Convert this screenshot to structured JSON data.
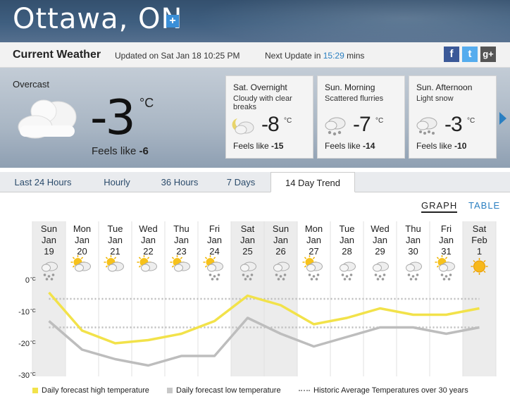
{
  "header": {
    "city": "Ottawa, ON",
    "add_label": "+"
  },
  "current_bar": {
    "title": "Current Weather",
    "updated": "Updated on Sat Jan 18 10:25 PM",
    "next_update_prefix": "Next Update in ",
    "next_update_time": "15:29",
    "next_update_suffix": " mins",
    "social": [
      "f",
      "t",
      "g+"
    ]
  },
  "current": {
    "condition": "Overcast",
    "temp": "-3",
    "unit": "°C",
    "feels_prefix": "Feels like ",
    "feels_value": "-6",
    "icon": "cloud-icon"
  },
  "forecast": [
    {
      "name": "Sat. Overnight",
      "cond": "Cloudy with clear breaks",
      "temp": "-8",
      "unit": "°C",
      "feels_prefix": "Feels like ",
      "feels_value": "-15",
      "icon": "cloudy-night-icon"
    },
    {
      "name": "Sun. Morning",
      "cond": "Scattered flurries",
      "temp": "-7",
      "unit": "°C",
      "feels_prefix": "Feels like ",
      "feels_value": "-14",
      "icon": "flurries-icon"
    },
    {
      "name": "Sun. Afternoon",
      "cond": "Light snow",
      "temp": "-3",
      "unit": "°C",
      "feels_prefix": "Feels like ",
      "feels_value": "-10",
      "icon": "snow-icon"
    }
  ],
  "tabs": [
    {
      "label": "Last 24 Hours",
      "active": false
    },
    {
      "label": "Hourly",
      "active": false
    },
    {
      "label": "36 Hours",
      "active": false
    },
    {
      "label": "7 Days",
      "active": false
    },
    {
      "label": "14 Day Trend",
      "active": true
    }
  ],
  "view_toggle": {
    "graph": "GRAPH",
    "table": "TABLE"
  },
  "chart_data": {
    "type": "line",
    "days": [
      {
        "dow": "Sun",
        "mon": "Jan",
        "day": "19",
        "icon": "snow-icon",
        "weekend": true
      },
      {
        "dow": "Mon",
        "mon": "Jan",
        "day": "20",
        "icon": "sun-cloud-icon",
        "weekend": false
      },
      {
        "dow": "Tue",
        "mon": "Jan",
        "day": "21",
        "icon": "sun-cloud-icon",
        "weekend": false
      },
      {
        "dow": "Wed",
        "mon": "Jan",
        "day": "22",
        "icon": "sun-cloud-icon",
        "weekend": false
      },
      {
        "dow": "Thu",
        "mon": "Jan",
        "day": "23",
        "icon": "sun-cloud-icon",
        "weekend": false
      },
      {
        "dow": "Fri",
        "mon": "Jan",
        "day": "24",
        "icon": "sun-flurries-icon",
        "weekend": false
      },
      {
        "dow": "Sat",
        "mon": "Jan",
        "day": "25",
        "icon": "snow-icon",
        "weekend": true
      },
      {
        "dow": "Sun",
        "mon": "Jan",
        "day": "26",
        "icon": "flurries-icon",
        "weekend": true
      },
      {
        "dow": "Mon",
        "mon": "Jan",
        "day": "27",
        "icon": "sun-flurries-icon",
        "weekend": false
      },
      {
        "dow": "Tue",
        "mon": "Jan",
        "day": "28",
        "icon": "snow-icon",
        "weekend": false
      },
      {
        "dow": "Wed",
        "mon": "Jan",
        "day": "29",
        "icon": "flurries-icon",
        "weekend": false
      },
      {
        "dow": "Thu",
        "mon": "Jan",
        "day": "30",
        "icon": "snow-icon",
        "weekend": false
      },
      {
        "dow": "Fri",
        "mon": "Jan",
        "day": "31",
        "icon": "sun-flurries-icon",
        "weekend": false
      },
      {
        "dow": "Sat",
        "mon": "Feb",
        "day": "1",
        "icon": "sun-icon",
        "weekend": true
      }
    ],
    "yticks": [
      {
        "value": 0,
        "label": "0",
        "unit": "°C"
      },
      {
        "value": -10,
        "label": "-10",
        "unit": "°C"
      },
      {
        "value": -20,
        "label": "-20",
        "unit": "°C"
      },
      {
        "value": -30,
        "label": "-30",
        "unit": "°C"
      }
    ],
    "ylim": [
      -30,
      0
    ],
    "series": [
      {
        "name": "Daily forecast high temperature",
        "color": "#f2e24a",
        "values": [
          -4,
          -16,
          -20,
          -19,
          -17,
          -13,
          -5,
          -8,
          -14,
          -12,
          -9,
          -11,
          -11,
          -9
        ]
      },
      {
        "name": "Daily forecast low temperature",
        "color": "#bdbdbd",
        "values": [
          -13,
          -22,
          -25,
          -27,
          -24,
          -24,
          -12,
          -17,
          -21,
          -18,
          -15,
          -15,
          -17,
          -15
        ]
      },
      {
        "name": "Historic Average Temperatures over 30 years",
        "color": "#c8c8c8",
        "dashed": true,
        "values": [
          -6,
          -6,
          -6,
          -6,
          -6,
          -6,
          -6,
          -6,
          -6,
          -6,
          -6,
          -6,
          -6,
          -6
        ],
        "values_low": [
          -15,
          -15,
          -15,
          -15,
          -15,
          -15,
          -15,
          -15,
          -15,
          -15,
          -15,
          -15,
          -15,
          -15
        ]
      }
    ]
  },
  "legend": [
    {
      "label": "Daily forecast high temperature",
      "color": "#f2e24a"
    },
    {
      "label": "Daily forecast low temperature",
      "color": "#c8c8c8"
    },
    {
      "label": "Historic Average Temperatures over 30 years",
      "color": "#9a9a9a"
    }
  ]
}
